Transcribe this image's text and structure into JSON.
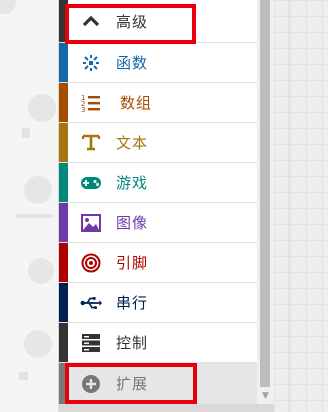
{
  "categories": [
    {
      "key": "advanced",
      "label": "高级",
      "color": "#333333",
      "stripe": "#333333",
      "icon": "chevron-up-icon"
    },
    {
      "key": "functions",
      "label": "函数",
      "color": "#1466a6",
      "stripe": "#1466a6",
      "icon": "function-icon"
    },
    {
      "key": "arrays",
      "label": "数组",
      "color": "#a64d00",
      "stripe": "#a64d00",
      "icon": "array-list-icon"
    },
    {
      "key": "text",
      "label": "文本",
      "color": "#a4760d",
      "stripe": "#a4760d",
      "icon": "text-icon"
    },
    {
      "key": "game",
      "label": "游戏",
      "color": "#00897b",
      "stripe": "#00897b",
      "icon": "gamepad-icon"
    },
    {
      "key": "images",
      "label": "图像",
      "color": "#6e3aa8",
      "stripe": "#6e3aa8",
      "icon": "image-icon"
    },
    {
      "key": "pins",
      "label": "引脚",
      "color": "#b10000",
      "stripe": "#b10000",
      "icon": "target-icon"
    },
    {
      "key": "serial",
      "label": "串行",
      "color": "#002050",
      "stripe": "#002050",
      "icon": "usb-icon"
    },
    {
      "key": "control",
      "label": "控制",
      "color": "#333333",
      "stripe": "#333333",
      "icon": "server-icon"
    },
    {
      "key": "extensions",
      "label": "扩展",
      "color": "#777777",
      "stripe": "#7a7a7a",
      "icon": "plus-circle-icon"
    }
  ],
  "highlight_color": "#e8000d"
}
